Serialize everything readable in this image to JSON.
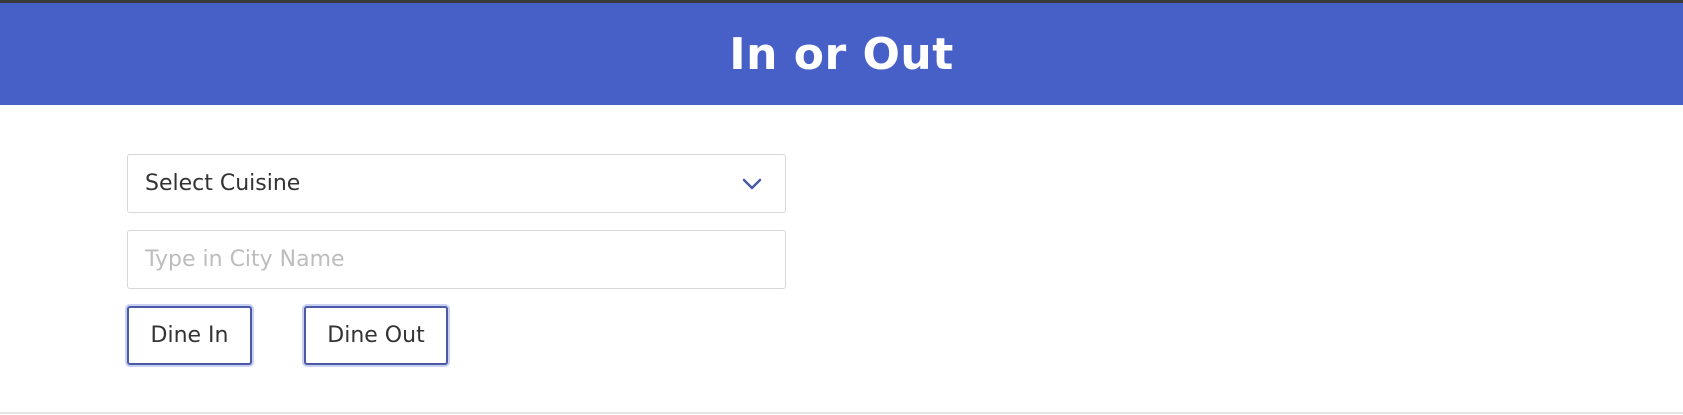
{
  "header": {
    "title": "In or Out",
    "background_color": "#4760c8"
  },
  "form": {
    "cuisine_select": {
      "selected": "Select Cuisine",
      "icon": "chevron-down-icon"
    },
    "city_input": {
      "value": "",
      "placeholder": "Type in City Name"
    },
    "buttons": {
      "dine_in": "Dine In",
      "dine_out": "Dine Out"
    }
  }
}
